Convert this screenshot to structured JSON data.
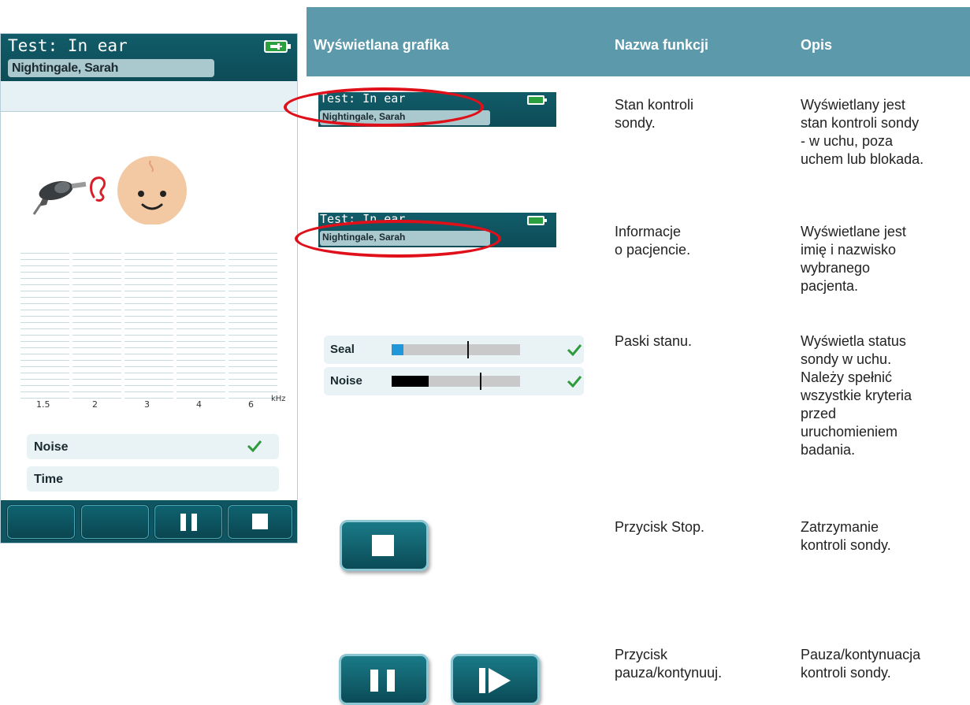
{
  "device": {
    "title": "Test: In ear",
    "patient": "Nightingale, Sarah",
    "freq_ticks": [
      "1.5",
      "2",
      "3",
      "4",
      "6"
    ],
    "freq_unit": "kHz",
    "status_rows": [
      "Noise",
      "Time"
    ]
  },
  "table": {
    "headers": {
      "graphic": "Wyświetlana grafika",
      "function": "Nazwa funkcji",
      "description": "Opis"
    },
    "rows": [
      {
        "name": [
          "Stan kontroli",
          "sondy."
        ],
        "desc": [
          "Wyświetlany jest",
          "stan kontroli sondy",
          "- w uchu, poza",
          "uchem lub blokada."
        ]
      },
      {
        "name": [
          "Informacje",
          "o pacjencie."
        ],
        "desc": [
          "Wyświetlane jest",
          "imię i nazwisko",
          "wybranego",
          "pacjenta."
        ]
      },
      {
        "name": [
          "Paski stanu."
        ],
        "desc": [
          "Wyświetla status",
          "sondy w uchu.",
          "Należy spełnić",
          "wszystkie kryteria",
          "przed",
          "uruchomieniem",
          "badania."
        ]
      },
      {
        "name": [
          "Przycisk Stop."
        ],
        "desc": [
          "Zatrzymanie",
          "kontroli sondy."
        ]
      },
      {
        "name": [
          "Przycisk",
          "pauza/kontynuuj."
        ],
        "desc": [
          "Pauza/kontynuacja",
          "kontroli sondy."
        ]
      }
    ]
  },
  "images": {
    "mini_title": "Test: In ear",
    "mini_patient": "Nightingale, Sarah",
    "status_bars": [
      {
        "label": "Seal",
        "fill_percent": 9,
        "marker_percent": 59,
        "fill_color": "#2196d8"
      },
      {
        "label": "Noise",
        "fill_percent": 29,
        "marker_percent": 69,
        "fill_color": "#000000"
      }
    ]
  },
  "colors": {
    "header_teal": "#5c99aa",
    "device_teal": "#0f5561",
    "highlight_red": "#e0101a",
    "check_green": "#2e9a3c"
  }
}
